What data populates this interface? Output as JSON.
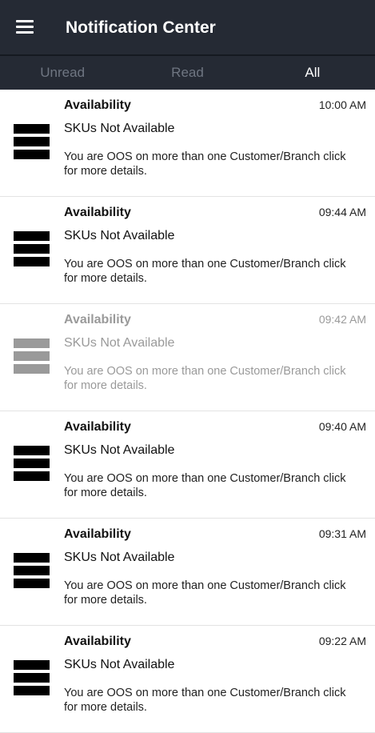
{
  "header": {
    "title": "Notification Center",
    "menu_icon": "hamburger-menu-icon"
  },
  "tabs": [
    {
      "label": "Unread",
      "active": false
    },
    {
      "label": "Read",
      "active": false
    },
    {
      "label": "All",
      "active": true
    }
  ],
  "colors": {
    "appbar": "#252a34",
    "tab_inactive": "#6f7682",
    "read_item_text": "#9a9a9a"
  },
  "notifications": [
    {
      "title": "Availability",
      "time": "10:00 AM",
      "subtitle": "SKUs Not Available",
      "body": "You are OOS on more than one Customer/Branch click for more details.",
      "read": false,
      "icon": "stacked-bars-icon"
    },
    {
      "title": "Availability",
      "time": "09:44 AM",
      "subtitle": "SKUs Not Available",
      "body": "You are OOS on more than one Customer/Branch click for more details.",
      "read": false,
      "icon": "stacked-bars-icon"
    },
    {
      "title": "Availability",
      "time": "09:42 AM",
      "subtitle": "SKUs Not Available",
      "body": "You are OOS on more than one Customer/Branch click for more details.",
      "read": true,
      "icon": "stacked-bars-icon"
    },
    {
      "title": "Availability",
      "time": "09:40 AM",
      "subtitle": "SKUs Not Available",
      "body": "You are OOS on more than one Customer/Branch click for more details.",
      "read": false,
      "icon": "stacked-bars-icon"
    },
    {
      "title": "Availability",
      "time": "09:31 AM",
      "subtitle": "SKUs Not Available",
      "body": "You are OOS on more than one Customer/Branch click for more details.",
      "read": false,
      "icon": "stacked-bars-icon"
    },
    {
      "title": "Availability",
      "time": "09:22 AM",
      "subtitle": "SKUs Not Available",
      "body": "You are OOS on more than one Customer/Branch click for more details.",
      "read": false,
      "icon": "stacked-bars-icon"
    }
  ]
}
